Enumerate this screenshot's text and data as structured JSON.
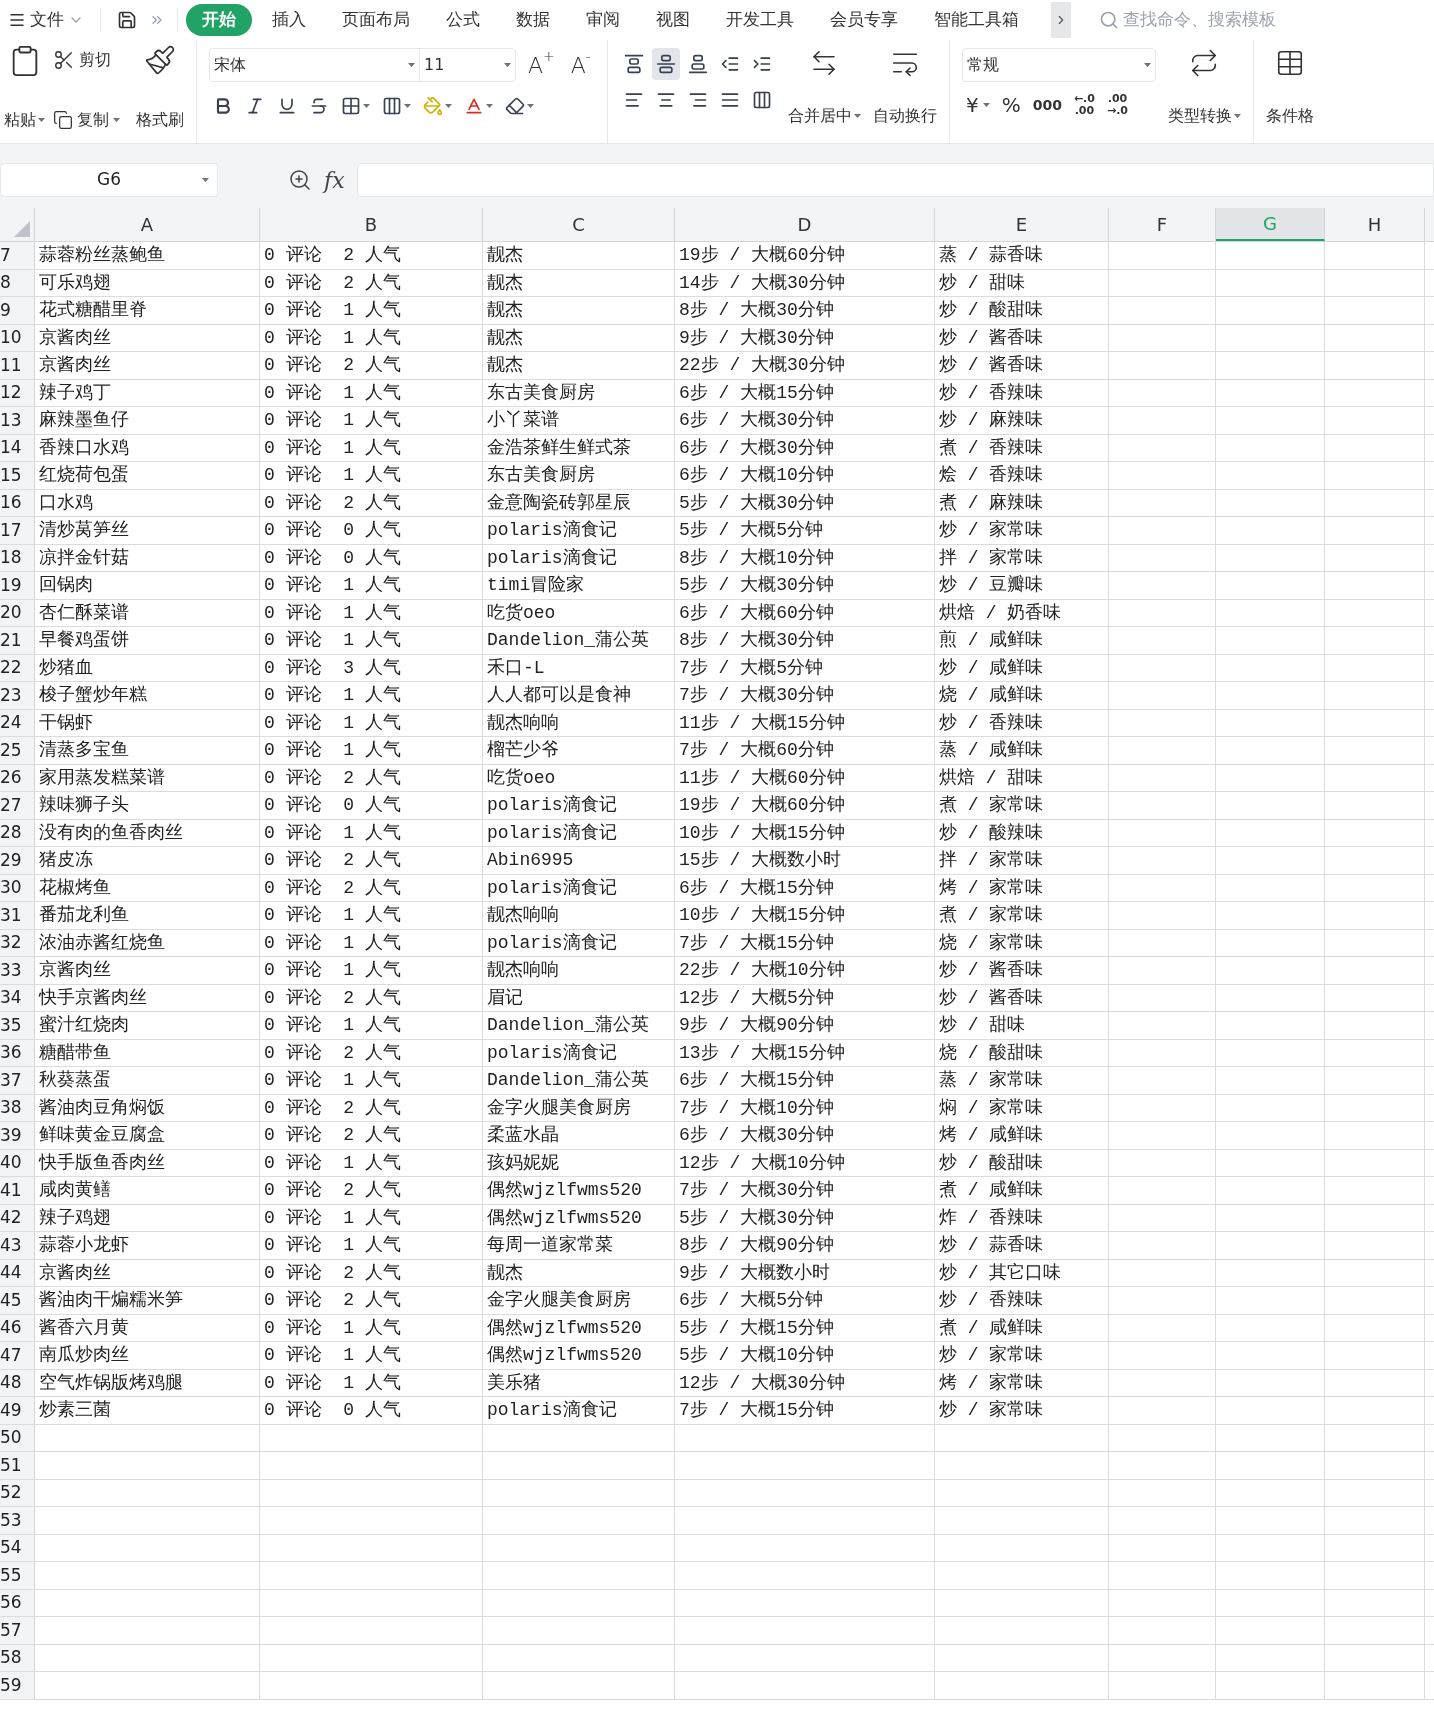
{
  "menu": {
    "file": "文件"
  },
  "tabs": [
    {
      "label": "开始",
      "selected": true
    },
    {
      "label": "插入",
      "selected": false
    },
    {
      "label": "页面布局",
      "selected": false
    },
    {
      "label": "公式",
      "selected": false
    },
    {
      "label": "数据",
      "selected": false
    },
    {
      "label": "审阅",
      "selected": false
    },
    {
      "label": "视图",
      "selected": false
    },
    {
      "label": "开发工具",
      "selected": false
    },
    {
      "label": "会员专享",
      "selected": false
    },
    {
      "label": "智能工具箱",
      "selected": false
    }
  ],
  "search": {
    "placeholder": "查找命令、搜索模板"
  },
  "ribbon": {
    "grow_font": {
      "letter": "A",
      "sign": "+"
    },
    "shrink_font": {
      "letter": "A",
      "sign": "-"
    },
    "paste": "粘贴",
    "cut": "剪切",
    "copy": "复制",
    "format_painter": "格式刷",
    "font": "宋体",
    "font_size": "11",
    "align_buttons": [
      {
        "kind": "top",
        "selected": false
      },
      {
        "kind": "middle",
        "selected": true
      },
      {
        "kind": "bottom",
        "selected": false
      }
    ],
    "merge": "合并居中",
    "wrap": "自动换行",
    "number_format": "常规",
    "currency": "¥",
    "percent": "%",
    "thousands": "000",
    "decimal_increase": {
      "top": "←.0",
      "bottom": ".00"
    },
    "decimal_decrease": {
      "top": ".00",
      "bottom": "→.0"
    },
    "convert": "类型转换",
    "conditional": "条件格"
  },
  "formula_bar": {
    "name_box": "G6",
    "fx": "fx"
  },
  "columns": [
    {
      "label": "A",
      "selected": false
    },
    {
      "label": "B",
      "selected": false
    },
    {
      "label": "C",
      "selected": false
    },
    {
      "label": "D",
      "selected": false
    },
    {
      "label": "E",
      "selected": false
    },
    {
      "label": "F",
      "selected": false
    },
    {
      "label": "G",
      "selected": true
    },
    {
      "label": "H",
      "selected": false
    }
  ],
  "rows": [
    {
      "number": "7",
      "cells": [
        "蒜蓉粉丝蒸鲍鱼",
        "0 评论  2 人气",
        "靓杰",
        "19步 / 大概60分钟",
        "蒸 / 蒜香味"
      ]
    },
    {
      "number": "8",
      "cells": [
        "可乐鸡翅",
        "0 评论  2 人气",
        "靓杰",
        "14步 / 大概30分钟",
        "炒 / 甜味"
      ]
    },
    {
      "number": "9",
      "cells": [
        "花式糖醋里脊",
        "0 评论  1 人气",
        "靓杰",
        "8步 / 大概30分钟",
        "炒 / 酸甜味"
      ]
    },
    {
      "number": "10",
      "cells": [
        "京酱肉丝",
        "0 评论  1 人气",
        "靓杰",
        "9步 / 大概30分钟",
        "炒 / 酱香味"
      ]
    },
    {
      "number": "11",
      "cells": [
        "京酱肉丝",
        "0 评论  2 人气",
        "靓杰",
        "22步 / 大概30分钟",
        "炒 / 酱香味"
      ]
    },
    {
      "number": "12",
      "cells": [
        "辣子鸡丁",
        "0 评论  1 人气",
        "东古美食厨房",
        "6步 / 大概15分钟",
        "炒 / 香辣味"
      ]
    },
    {
      "number": "13",
      "cells": [
        "麻辣墨鱼仔",
        "0 评论  1 人气",
        "小丫菜谱",
        "6步 / 大概30分钟",
        "炒 / 麻辣味"
      ]
    },
    {
      "number": "14",
      "cells": [
        "香辣口水鸡",
        "0 评论  1 人气",
        "金浩茶鲜生鲜式茶",
        "6步 / 大概30分钟",
        "煮 / 香辣味"
      ]
    },
    {
      "number": "15",
      "cells": [
        "红烧荷包蛋",
        "0 评论  1 人气",
        "东古美食厨房",
        "6步 / 大概10分钟",
        "烩 / 香辣味"
      ]
    },
    {
      "number": "16",
      "cells": [
        "口水鸡",
        "0 评论  2 人气",
        "金意陶瓷砖郭星辰",
        "5步 / 大概30分钟",
        "煮 / 麻辣味"
      ]
    },
    {
      "number": "17",
      "cells": [
        "清炒莴笋丝",
        "0 评论  0 人气",
        "polaris滴食记",
        "5步 / 大概5分钟",
        "炒 / 家常味"
      ]
    },
    {
      "number": "18",
      "cells": [
        "凉拌金针菇",
        "0 评论  0 人气",
        "polaris滴食记",
        "8步 / 大概10分钟",
        "拌 / 家常味"
      ]
    },
    {
      "number": "19",
      "cells": [
        "回锅肉",
        "0 评论  1 人气",
        "timi冒险家",
        "5步 / 大概30分钟",
        "炒 / 豆瓣味"
      ]
    },
    {
      "number": "20",
      "cells": [
        "杏仁酥菜谱",
        "0 评论  1 人气",
        "吃货oeo",
        "6步 / 大概60分钟",
        "烘焙 / 奶香味"
      ]
    },
    {
      "number": "21",
      "cells": [
        "早餐鸡蛋饼",
        "0 评论  1 人气",
        "Dandelion_蒲公英",
        "8步 / 大概30分钟",
        "煎 / 咸鲜味"
      ]
    },
    {
      "number": "22",
      "cells": [
        "炒猪血",
        "0 评论  3 人气",
        "禾口-L",
        "7步 / 大概5分钟",
        "炒 / 咸鲜味"
      ]
    },
    {
      "number": "23",
      "cells": [
        "梭子蟹炒年糕",
        "0 评论  1 人气",
        "人人都可以是食神",
        "7步 / 大概30分钟",
        "烧 / 咸鲜味"
      ]
    },
    {
      "number": "24",
      "cells": [
        "干锅虾",
        "0 评论  1 人气",
        "靓杰响响",
        "11步 / 大概15分钟",
        "炒 / 香辣味"
      ]
    },
    {
      "number": "25",
      "cells": [
        "清蒸多宝鱼",
        "0 评论  1 人气",
        "榴芒少爷",
        "7步 / 大概60分钟",
        "蒸 / 咸鲜味"
      ]
    },
    {
      "number": "26",
      "cells": [
        "家用蒸发糕菜谱",
        "0 评论  2 人气",
        "吃货oeo",
        "11步 / 大概60分钟",
        "烘焙 / 甜味"
      ]
    },
    {
      "number": "27",
      "cells": [
        "辣味狮子头",
        "0 评论  0 人气",
        "polaris滴食记",
        "19步 / 大概60分钟",
        "煮 / 家常味"
      ]
    },
    {
      "number": "28",
      "cells": [
        "没有肉的鱼香肉丝",
        "0 评论  1 人气",
        "polaris滴食记",
        "10步 / 大概15分钟",
        "炒 / 酸辣味"
      ]
    },
    {
      "number": "29",
      "cells": [
        "猪皮冻",
        "0 评论  2 人气",
        "Abin6995",
        "15步 / 大概数小时",
        "拌 / 家常味"
      ]
    },
    {
      "number": "30",
      "cells": [
        "花椒烤鱼",
        "0 评论  2 人气",
        "polaris滴食记",
        "6步 / 大概15分钟",
        "烤 / 家常味"
      ]
    },
    {
      "number": "31",
      "cells": [
        "番茄龙利鱼",
        "0 评论  1 人气",
        "靓杰响响",
        "10步 / 大概15分钟",
        "煮 / 家常味"
      ]
    },
    {
      "number": "32",
      "cells": [
        "浓油赤酱红烧鱼",
        "0 评论  1 人气",
        "polaris滴食记",
        "7步 / 大概15分钟",
        "烧 / 家常味"
      ]
    },
    {
      "number": "33",
      "cells": [
        "京酱肉丝",
        "0 评论  1 人气",
        "靓杰响响",
        "22步 / 大概10分钟",
        "炒 / 酱香味"
      ]
    },
    {
      "number": "34",
      "cells": [
        "快手京酱肉丝",
        "0 评论  2 人气",
        "眉记",
        "12步 / 大概5分钟",
        "炒 / 酱香味"
      ]
    },
    {
      "number": "35",
      "cells": [
        "蜜汁红烧肉",
        "0 评论  1 人气",
        "Dandelion_蒲公英",
        "9步 / 大概90分钟",
        "炒 / 甜味"
      ]
    },
    {
      "number": "36",
      "cells": [
        "糖醋带鱼",
        "0 评论  2 人气",
        "polaris滴食记",
        "13步 / 大概15分钟",
        "烧 / 酸甜味"
      ]
    },
    {
      "number": "37",
      "cells": [
        "秋葵蒸蛋",
        "0 评论  1 人气",
        "Dandelion_蒲公英",
        "6步 / 大概15分钟",
        "蒸 / 家常味"
      ]
    },
    {
      "number": "38",
      "cells": [
        "酱油肉豆角焖饭",
        "0 评论  2 人气",
        "金字火腿美食厨房",
        "7步 / 大概10分钟",
        "焖 / 家常味"
      ]
    },
    {
      "number": "39",
      "cells": [
        "鲜味黄金豆腐盒",
        "0 评论  2 人气",
        "柔蓝水晶",
        "6步 / 大概30分钟",
        "烤 / 咸鲜味"
      ]
    },
    {
      "number": "40",
      "cells": [
        "快手版鱼香肉丝",
        "0 评论  1 人气",
        "孩妈妮妮",
        "12步 / 大概10分钟",
        "炒 / 酸甜味"
      ]
    },
    {
      "number": "41",
      "cells": [
        "咸肉黄鳝",
        "0 评论  2 人气",
        "偶然wjzlfwms520",
        "7步 / 大概30分钟",
        "煮 / 咸鲜味"
      ]
    },
    {
      "number": "42",
      "cells": [
        "辣子鸡翅",
        "0 评论  1 人气",
        "偶然wjzlfwms520",
        "5步 / 大概30分钟",
        "炸 / 香辣味"
      ]
    },
    {
      "number": "43",
      "cells": [
        "蒜蓉小龙虾",
        "0 评论  1 人气",
        "每周一道家常菜",
        "8步 / 大概90分钟",
        "炒 / 蒜香味"
      ]
    },
    {
      "number": "44",
      "cells": [
        "京酱肉丝",
        "0 评论  2 人气",
        "靓杰",
        "9步 / 大概数小时",
        "炒 / 其它口味"
      ]
    },
    {
      "number": "45",
      "cells": [
        "酱油肉干煸糯米笋",
        "0 评论  2 人气",
        "金字火腿美食厨房",
        "6步 / 大概5分钟",
        "炒 / 香辣味"
      ]
    },
    {
      "number": "46",
      "cells": [
        "酱香六月黄",
        "0 评论  1 人气",
        "偶然wjzlfwms520",
        "5步 / 大概15分钟",
        "煮 / 咸鲜味"
      ]
    },
    {
      "number": "47",
      "cells": [
        "南瓜炒肉丝",
        "0 评论  1 人气",
        "偶然wjzlfwms520",
        "5步 / 大概10分钟",
        "炒 / 家常味"
      ]
    },
    {
      "number": "48",
      "cells": [
        "空气炸锅版烤鸡腿",
        "0 评论  1 人气",
        "美乐猪",
        "12步 / 大概30分钟",
        "烤 / 家常味"
      ]
    },
    {
      "number": "49",
      "cells": [
        "炒素三菌",
        "0 评论  0 人气",
        "polaris滴食记",
        "7步 / 大概15分钟",
        "炒 / 家常味"
      ]
    },
    {
      "number": "50"
    },
    {
      "number": "51"
    },
    {
      "number": "52"
    },
    {
      "number": "53"
    },
    {
      "number": "54"
    },
    {
      "number": "55"
    },
    {
      "number": "56"
    },
    {
      "number": "57"
    },
    {
      "number": "58"
    },
    {
      "number": "59"
    }
  ]
}
